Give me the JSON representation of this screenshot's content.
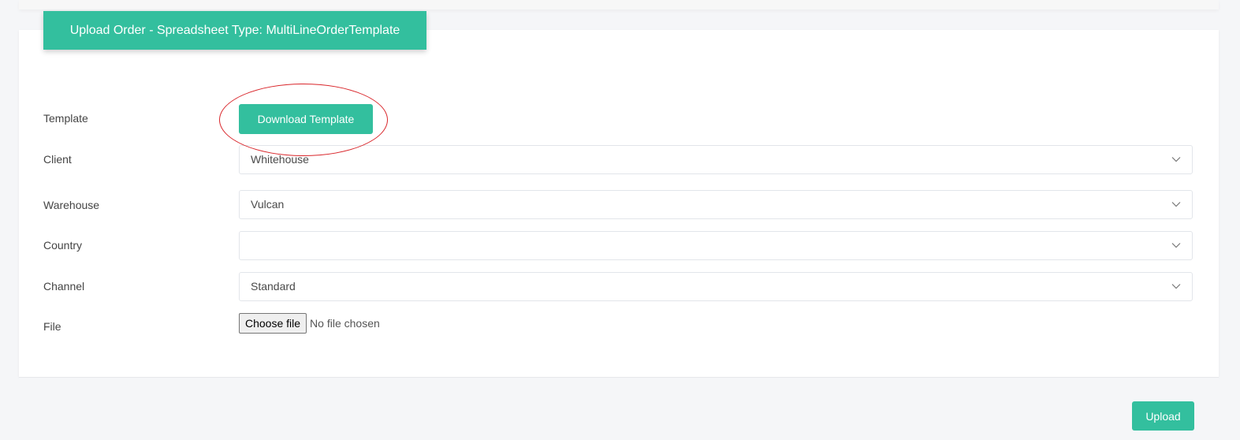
{
  "header": {
    "title": "Upload Order - Spreadsheet Type: MultiLineOrderTemplate"
  },
  "form": {
    "template": {
      "label": "Template",
      "button_label": "Download Template"
    },
    "client": {
      "label": "Client",
      "value": "Whitehouse"
    },
    "warehouse": {
      "label": "Warehouse",
      "value": "Vulcan"
    },
    "country": {
      "label": "Country",
      "value": ""
    },
    "channel": {
      "label": "Channel",
      "value": "Standard"
    },
    "file": {
      "label": "File",
      "button_label": "Choose file",
      "status": "No file chosen"
    }
  },
  "footer": {
    "upload_label": "Upload"
  },
  "colors": {
    "accent": "#33bf9e",
    "highlight": "#d9262b"
  }
}
